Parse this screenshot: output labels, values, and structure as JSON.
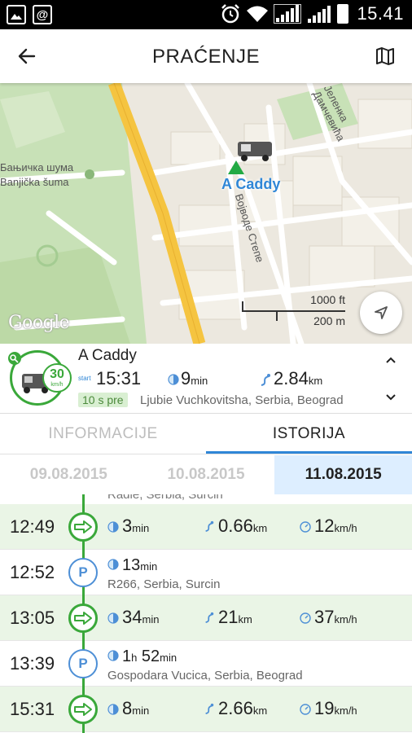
{
  "status_bar": {
    "left_icons": [
      "image-icon",
      "at-icon"
    ],
    "time": "15.41"
  },
  "app_bar": {
    "title": "PRAĆENJE"
  },
  "map": {
    "street_labels": [
      "Бањичка шума",
      "Banjička šuma",
      "Војводе Степе",
      "Јеленка Дамчевића"
    ],
    "vehicle_label": "A Caddy",
    "scale_ft": "1000 ft",
    "scale_m": "200 m",
    "logo": "Google",
    "colors": {
      "park": "#c8e1b7",
      "road_major": "#f5c440",
      "road": "#ffffff",
      "land": "#ece8df",
      "vehicle_marker": "#22aa44",
      "vehicle_text": "#2f86d6"
    }
  },
  "vehicle": {
    "name": "A Caddy",
    "speed": "30",
    "speed_unit": "km/h",
    "start_label": "start",
    "start_time": "15:31",
    "duration": "9",
    "duration_unit": "min",
    "distance": "2.84",
    "distance_unit": "km",
    "ago": "10 s pre",
    "location": "Ljubie Vuchkovitsha, Serbia, Beograd"
  },
  "tabs": [
    {
      "label": "INFORMACIJE",
      "active": false
    },
    {
      "label": "ISTORIJA",
      "active": true
    }
  ],
  "dates": [
    {
      "label": "09.08.2015",
      "active": false
    },
    {
      "label": "10.08.2015",
      "active": false
    },
    {
      "label": "11.08.2015",
      "active": true
    }
  ],
  "history": {
    "partial_text": "Radie, Serbia, Surcin",
    "rows": [
      {
        "type": "trip",
        "time": "12:49",
        "duration": "3",
        "duration_unit": "min",
        "distance": "0.66",
        "distance_unit": "km",
        "speed": "12",
        "speed_unit": "km/h"
      },
      {
        "type": "stop",
        "time": "12:52",
        "duration": "13",
        "duration_unit": "min",
        "address": "R266, Serbia, Surcin"
      },
      {
        "type": "trip",
        "time": "13:05",
        "duration": "34",
        "duration_unit": "min",
        "distance": "21",
        "distance_unit": "km",
        "speed": "37",
        "speed_unit": "km/h"
      },
      {
        "type": "stop",
        "time": "13:39",
        "duration_h": "1",
        "h_unit": "h",
        "duration": "52",
        "duration_unit": "min",
        "address": "Gospodara Vucica, Serbia, Beograd"
      },
      {
        "type": "trip",
        "time": "15:31",
        "duration": "8",
        "duration_unit": "min",
        "distance": "2.66",
        "distance_unit": "km",
        "speed": "19",
        "speed_unit": "km/h"
      }
    ]
  }
}
